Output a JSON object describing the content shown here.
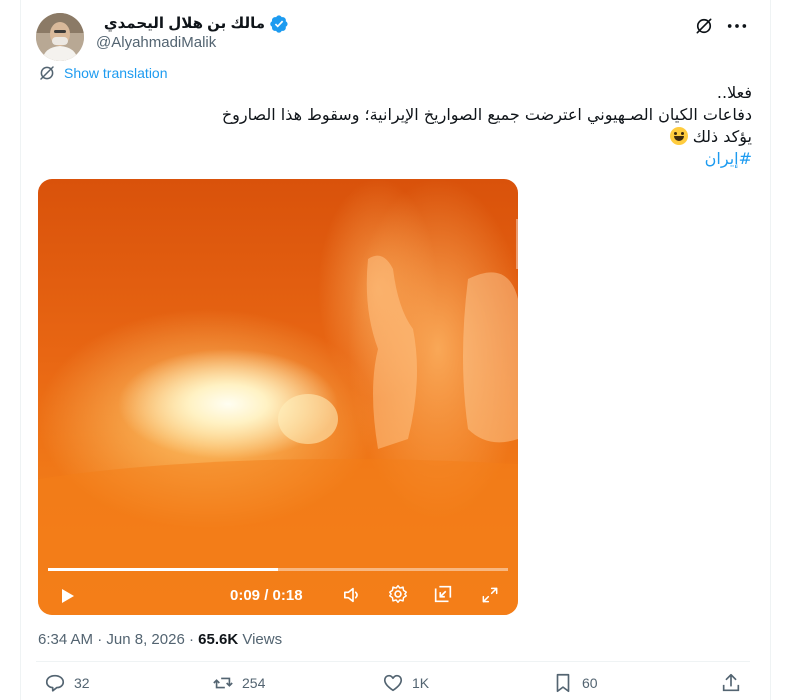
{
  "author": {
    "name": "مالك بن هلال اليحمدي",
    "handle": "@AlyahmadiMalik"
  },
  "translation": {
    "label": "Show translation"
  },
  "tweet": {
    "line1": "فعلا..",
    "line2": "دفاعات الكيان الصـهيوني اعترضت جميع الصواريخ الإيرانية؛ وسقوط هذا الصاروخ",
    "line3": "يؤكد ذلك",
    "hashtag": "#إيران"
  },
  "video": {
    "time": "0:09 / 0:18",
    "progress": 0.5
  },
  "meta": {
    "time": "6:34 AM",
    "date": "Jun 8, 2026",
    "views_count": "65.6K",
    "views_label": "Views",
    "sep": "·"
  },
  "actions": {
    "replies": "32",
    "reposts": "254",
    "likes": "1K",
    "bookmarks": "60"
  },
  "colors": {
    "accent": "#1d9bf0",
    "text": "#0f1419",
    "muted": "#536471"
  }
}
